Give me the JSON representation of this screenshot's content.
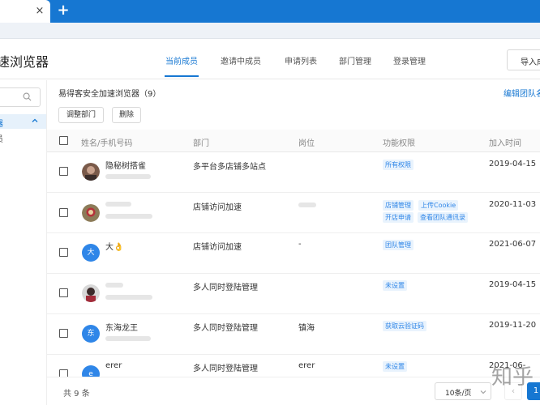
{
  "browser": {
    "tab_close": "×",
    "new_tab": "+"
  },
  "header": {
    "app_title": "速浏览器",
    "nav": [
      "当前成员",
      "邀请中成员",
      "申请列表",
      "部门管理",
      "登录管理"
    ],
    "import_label": "导入成"
  },
  "sidebar": {
    "active_item": "器",
    "item2": "员"
  },
  "main": {
    "group_title": "易得客安全加速浏览器（9）",
    "edit_link": "编辑团队名",
    "buttons": {
      "adjust_department": "调整部门",
      "delete": "删除"
    },
    "columns": [
      "姓名/手机号码",
      "部门",
      "岗位",
      "功能权限",
      "加入时间"
    ],
    "rows": [
      {
        "name": "隐秘树搭雀",
        "department": "多平台多店铺多站点",
        "position": "",
        "permissions": [
          "所有权限"
        ],
        "join_date": "2019-04-15",
        "avatar": ""
      },
      {
        "name": "",
        "department": "店铺访问加速",
        "position": "",
        "permissions": [
          "店铺管理",
          "上传Cookie",
          "开店申请",
          "查看团队通讯录"
        ],
        "join_date": "2020-11-03",
        "avatar": ""
      },
      {
        "name": "大👌",
        "department": "店铺访问加速",
        "position": "-",
        "permissions": [
          "团队管理"
        ],
        "join_date": "2021-06-07",
        "avatar": "大"
      },
      {
        "name": "",
        "department": "多人同时登陆管理",
        "position": "",
        "permissions": [
          "未设置"
        ],
        "join_date": "2019-04-15",
        "avatar": ""
      },
      {
        "name": "东海龙王",
        "department": "多人同时登陆管理",
        "position": "镇海",
        "permissions": [
          "获取云验证码"
        ],
        "join_date": "2019-11-20",
        "avatar": "东"
      },
      {
        "name": "erer",
        "department": "多人同时登陆管理",
        "position": "erer",
        "permissions": [
          "未设置"
        ],
        "join_date": "2021-06-",
        "avatar": "e"
      }
    ]
  },
  "footer": {
    "total": "共 9 条",
    "page_size": "10条/页",
    "prev": "‹",
    "current_page": "1"
  },
  "watermark": "知乎",
  "colors": {
    "accent": "#1677d2",
    "tag_bg": "#e9f3fd",
    "tag_text": "#2f86e8"
  }
}
